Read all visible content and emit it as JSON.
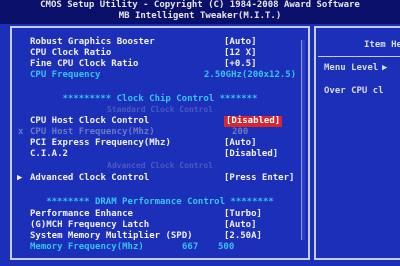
{
  "header": {
    "line1": "CMOS Setup Utility - Copyright (C) 1984-2008 Award Software",
    "line2": "MB Intelligent Tweaker(M.I.T.)"
  },
  "settings": {
    "robust_graphics_booster": {
      "label": "Robust Graphics Booster",
      "value": "[Auto]"
    },
    "cpu_clock_ratio": {
      "label": "CPU Clock Ratio",
      "value": "[12 X]"
    },
    "fine_cpu_clock_ratio": {
      "label": "Fine CPU Clock Ratio",
      "value": "[+0.5]"
    },
    "cpu_frequency": {
      "label": "CPU Frequency",
      "value": "2.50GHz(200x12.5)"
    },
    "clock_chip_section": "********* Clock Chip Control *******",
    "clock_chip_sub": "Standard Clock Control",
    "cpu_host_clock_control": {
      "label": "CPU Host Clock Control",
      "value": "[Disabled]"
    },
    "cpu_host_frequency": {
      "label": "CPU Host Frequency(Mhz)",
      "value": "200",
      "marker": "x"
    },
    "pci_express_frequency": {
      "label": "PCI Express Frequency(Mhz)",
      "value": "[Auto]"
    },
    "ciaz": {
      "label": "C.I.A.2",
      "value": "[Disabled]"
    },
    "advanced_clock_sub": "Advanced Clock Control",
    "advanced_clock_control": {
      "label": "Advanced Clock Control",
      "value": "[Press Enter]",
      "marker": "▶"
    },
    "dram_section": "******** DRAM Performance Control ********",
    "performance_enhance": {
      "label": "Performance Enhance",
      "value": "[Turbo]"
    },
    "gmch_frequency_latch": {
      "label": "(G)MCH Frequency Latch",
      "value": "[Auto]"
    },
    "system_memory_multiplier": {
      "label": "System Memory Multiplier (SPD)",
      "value": "[2.50A]"
    },
    "memory_frequency": {
      "label": "Memory Frequency(Mhz)",
      "value": "667",
      "value2": "500"
    }
  },
  "help_panel": {
    "title": "Item He",
    "menu_level": "Menu Level",
    "menu_level_marker": "▶",
    "desc": "Over CPU cl"
  },
  "colors": {
    "background": "#1c2fb8",
    "header_bg": "#0a0f6a",
    "accent_cyan": "#36c4f0",
    "highlight": "#d8262e"
  }
}
